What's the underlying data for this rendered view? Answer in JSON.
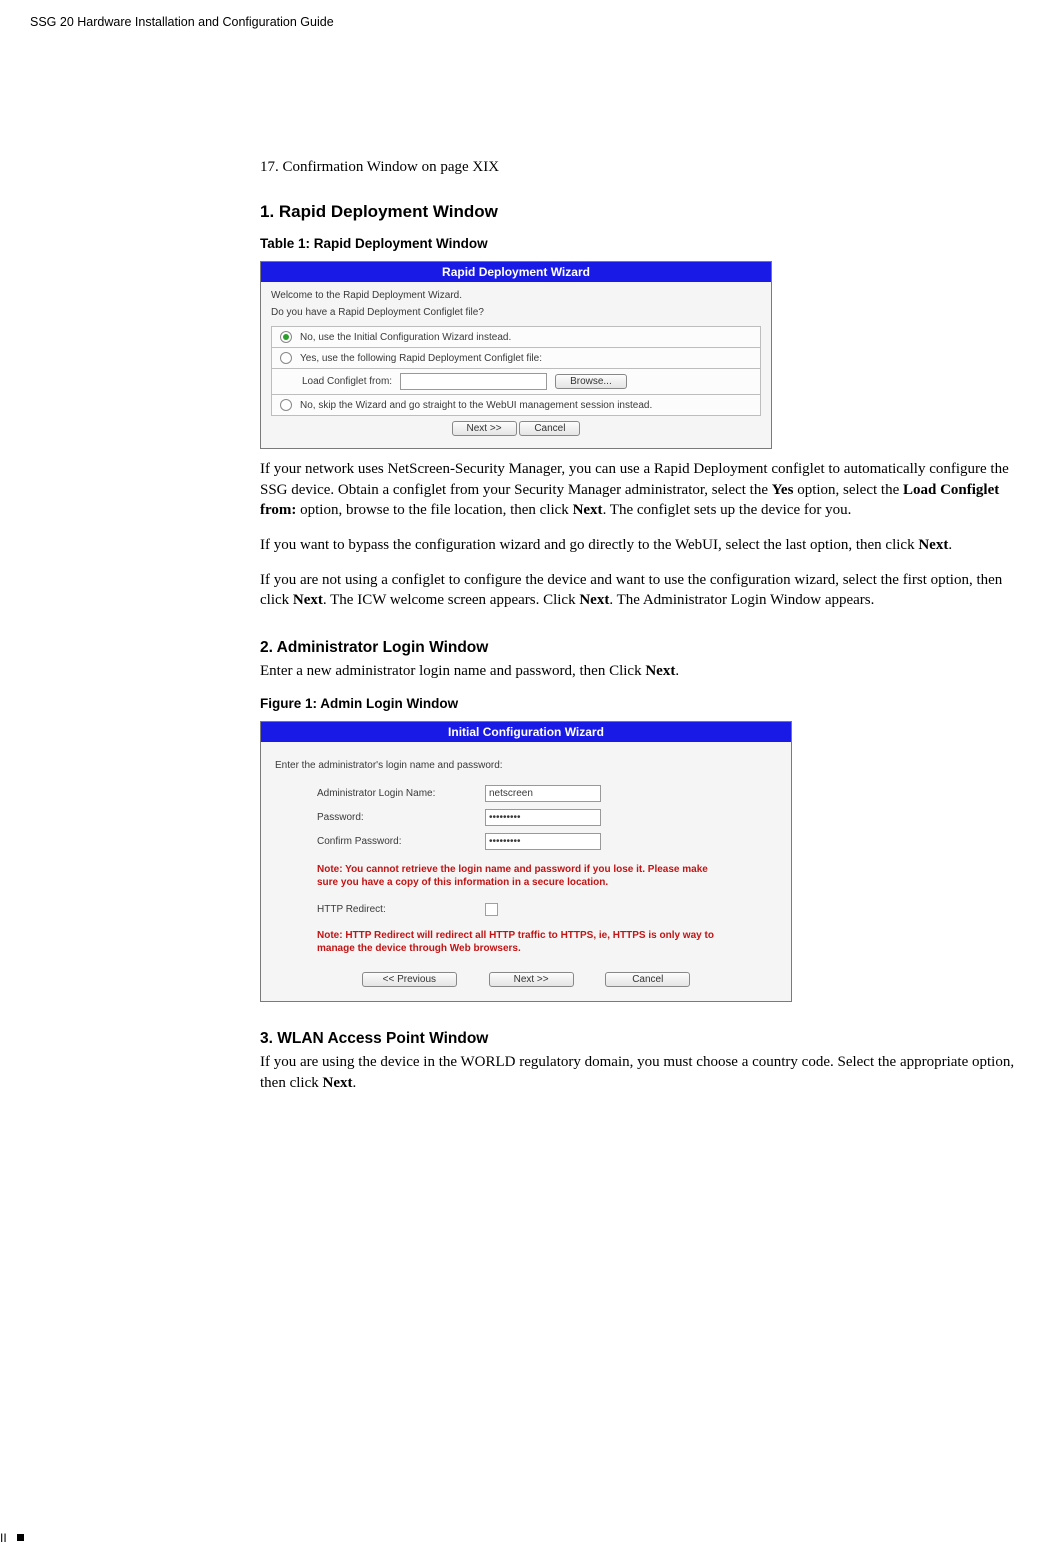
{
  "running_head": "SSG 20 Hardware Installation and Configuration Guide",
  "toc_line": "17. Confirmation Window on page XIX",
  "s1": {
    "title": "1. Rapid Deployment Window",
    "caption": "Table 1:  Rapid Deployment Window",
    "wizard": {
      "title": "Rapid Deployment Wizard",
      "welcome": "Welcome to the Rapid Deployment Wizard.",
      "question": "Do you have a Rapid Deployment Configlet file?",
      "opt1": "No, use the Initial Configuration Wizard instead.",
      "opt2": "Yes, use the following Rapid Deployment Configlet file:",
      "load_label": "Load Configlet from:",
      "browse": "Browse...",
      "opt3": "No, skip the Wizard and go straight to the WebUI management session instead.",
      "next": "Next >>",
      "cancel": "Cancel"
    },
    "p1a": "If your network uses NetScreen-Security Manager, you can use a Rapid Deployment configlet to automatically configure the SSG device. Obtain a configlet from your Security Manager administrator, select the ",
    "p1b": "Yes",
    "p1c": " option, select the ",
    "p1d": "Load Configlet from:",
    "p1e": " option, browse to the file location, then click ",
    "p1f": "Next",
    "p1g": ". The configlet sets up the device for you.",
    "p2a": "If you want to bypass the configuration wizard and go directly to the WebUI, select the last option, then click ",
    "p2b": "Next",
    "p2c": ".",
    "p3a": "If you are not using a configlet to configure the device and want to use the configuration wizard, select the first option, then click ",
    "p3b": "Next",
    "p3c": ". The ICW welcome screen appears. Click ",
    "p3d": "Next",
    "p3e": ". The Administrator Login Window appears."
  },
  "s2": {
    "title": "2. Administrator Login Window",
    "intro_a": "Enter a new administrator login name and password, then Click ",
    "intro_b": "Next",
    "intro_c": ".",
    "caption": "Figure 1:  Admin Login Window",
    "wizard": {
      "title": "Initial Configuration Wizard",
      "lead": "Enter the administrator's login name and password:",
      "login_label": "Administrator Login Name:",
      "login_value": "netscreen",
      "pw_label": "Password:",
      "pw_mask": "•••••••••",
      "cpw_label": "Confirm Password:",
      "cpw_mask": "•••••••••",
      "note1": "Note: You cannot retrieve the login name and password if you lose it. Please make sure you have a copy of this information in a secure location.",
      "http_label": "HTTP Redirect:",
      "note2": "Note: HTTP Redirect will redirect all HTTP traffic to HTTPS, ie, HTTPS is only way to manage the device through Web browsers.",
      "prev": "<< Previous",
      "next": "Next >>",
      "cancel": "Cancel"
    }
  },
  "s3": {
    "title": "3. WLAN Access Point Window",
    "p_a": "If you are using the device in the WORLD regulatory domain, you must choose a country code. Select the appropriate option, then click ",
    "p_b": "Next",
    "p_c": "."
  },
  "footer_roman": "II"
}
